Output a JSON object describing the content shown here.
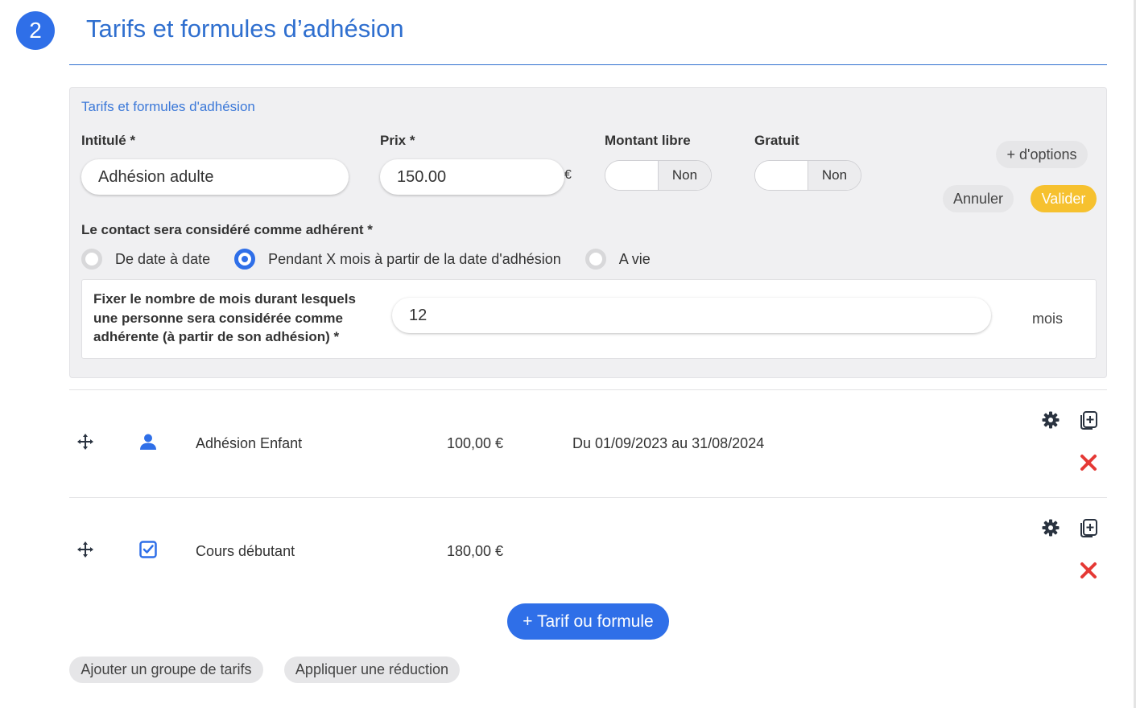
{
  "section": {
    "step_number": "2",
    "title": "Tarifs et formules d’adhésion"
  },
  "form": {
    "panel_title": "Tarifs et formules d'adhésion",
    "label_label": "Intitulé *",
    "label_value": "Adhésion adulte",
    "price_label": "Prix *",
    "price_value": "150.00",
    "currency": "€",
    "free_amount_label": "Montant libre",
    "free_amount_value": "Non",
    "free_label": "Gratuit",
    "free_value": "Non",
    "options_button": "+ d'options",
    "cancel_button": "Annuler",
    "validate_button": "Valider",
    "member_label": "Le contact sera considéré comme adhérent *",
    "radio_options": [
      {
        "label": "De date à date",
        "checked": false
      },
      {
        "label": "Pendant X mois à partir de la date d'adhésion",
        "checked": true
      },
      {
        "label": "A vie",
        "checked": false
      }
    ],
    "months_label": "Fixer le nombre de mois durant lesquels une personne sera considérée comme adhérente (à partir de son adhésion) *",
    "months_value": "12",
    "months_unit": "mois"
  },
  "tariffs": [
    {
      "icon": "person-icon",
      "name": "Adhésion Enfant",
      "price": "100,00 €",
      "period": "Du 01/09/2023 au 31/08/2024"
    },
    {
      "icon": "checkbox-icon",
      "name": "Cours débutant",
      "price": "180,00 €",
      "period": ""
    }
  ],
  "actions": {
    "add_tariff": "+ Tarif ou formule",
    "add_group": "Ajouter un groupe de tarifs",
    "apply_discount": "Appliquer une réduction"
  },
  "colors": {
    "accent_blue": "#2f6fe8",
    "title_blue": "#2f6fcf",
    "validate_yellow": "#f6c12f",
    "delete_red": "#e53935",
    "icon_dark": "#2a3340"
  }
}
